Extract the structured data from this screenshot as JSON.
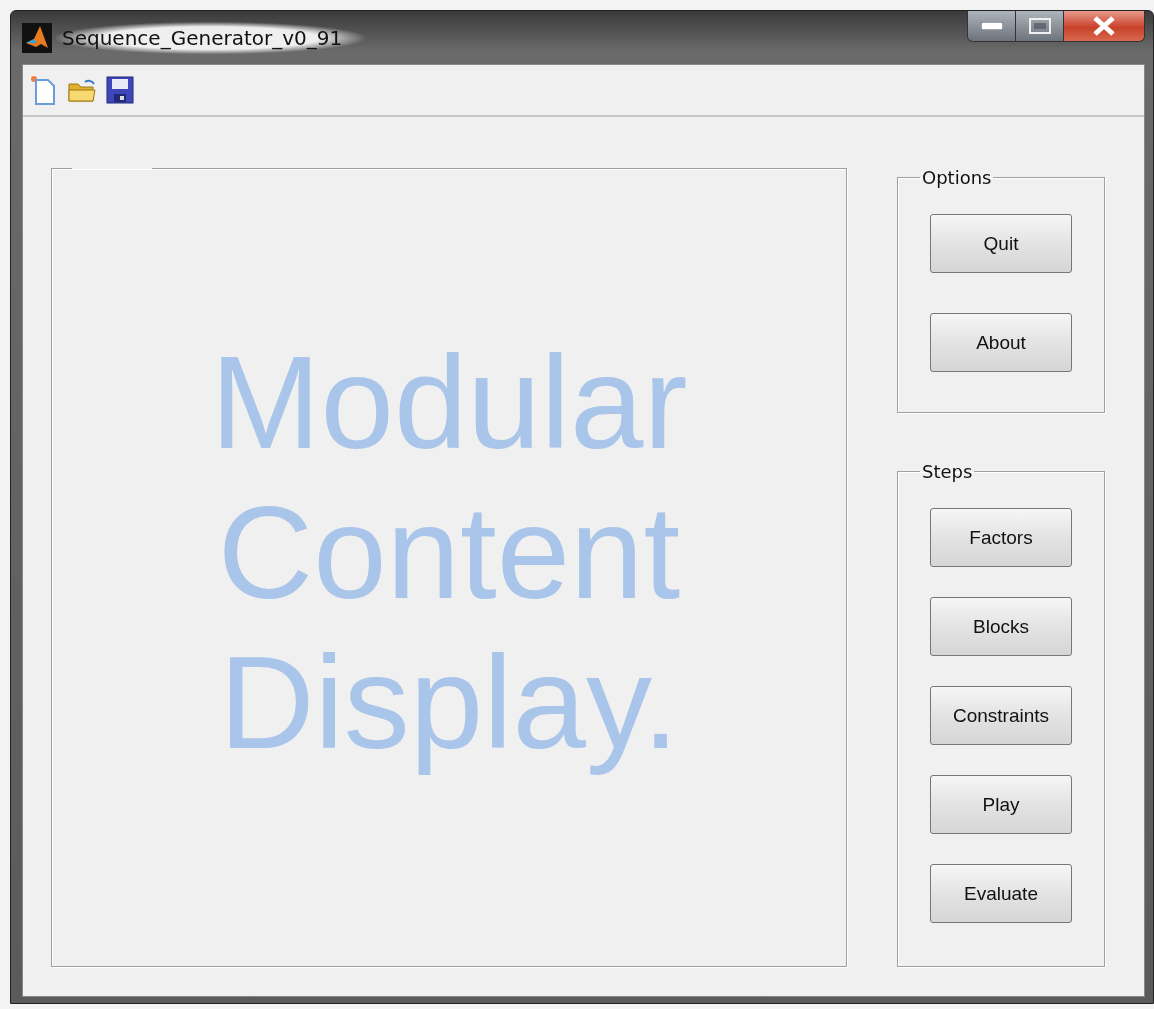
{
  "window": {
    "title": "Sequence_Generator_v0_91"
  },
  "toolbar": {
    "buttons": [
      {
        "kind": "new"
      },
      {
        "kind": "open"
      },
      {
        "kind": "save"
      }
    ]
  },
  "content_panel": {
    "text": "Modular Content Display."
  },
  "options_panel": {
    "title": "Options",
    "buttons": [
      "Quit",
      "About"
    ]
  },
  "steps_panel": {
    "title": "Steps",
    "buttons": [
      "Factors",
      "Blocks",
      "Constraints",
      "Play",
      "Evaluate"
    ]
  }
}
